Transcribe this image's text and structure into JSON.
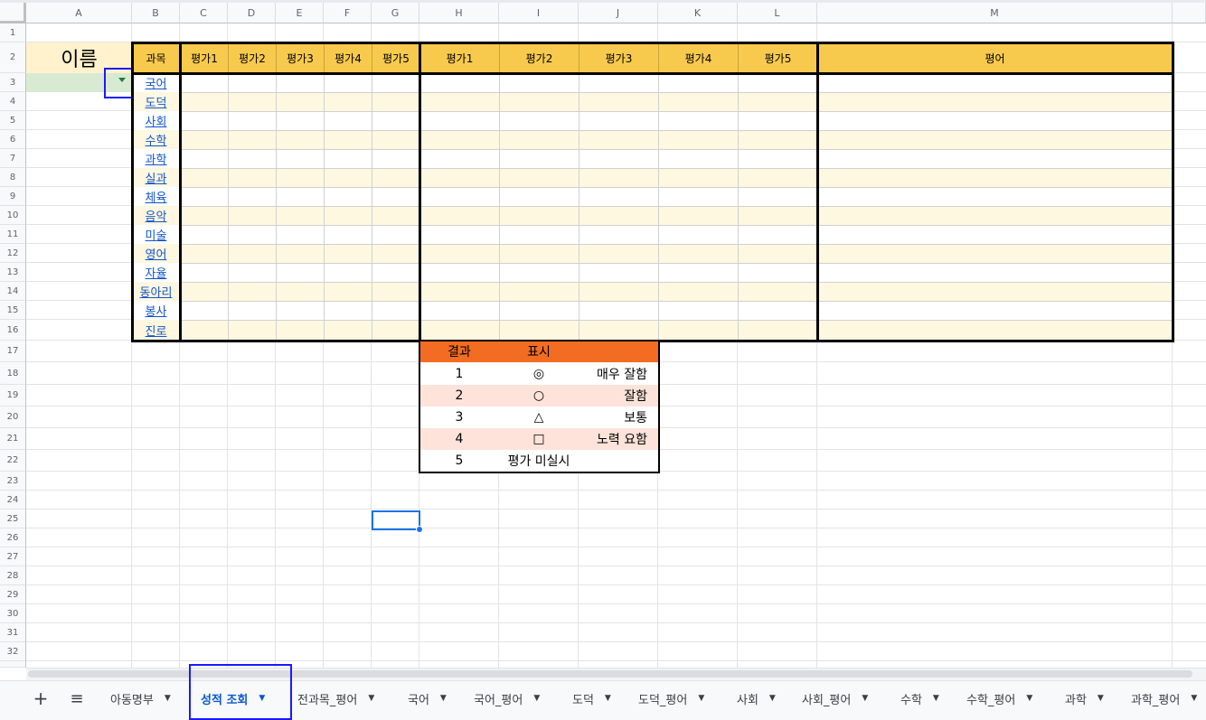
{
  "columns": [
    "A",
    "B",
    "C",
    "D",
    "E",
    "F",
    "G",
    "H",
    "I",
    "J",
    "K",
    "L",
    "M"
  ],
  "rows": [
    "1",
    "2",
    "3",
    "4",
    "5",
    "6",
    "7",
    "8",
    "9",
    "10",
    "11",
    "12",
    "13",
    "14",
    "15",
    "16",
    "17",
    "18",
    "19",
    "20",
    "21",
    "22",
    "23",
    "24",
    "25",
    "26",
    "27",
    "28",
    "29",
    "30",
    "31",
    "32"
  ],
  "name_label": "이름",
  "table": {
    "subject_header": "과목",
    "eval_headers_a": [
      "평가1",
      "평가2",
      "평가3",
      "평가4",
      "평가5"
    ],
    "eval_headers_b": [
      "평가1",
      "평가2",
      "평가3",
      "평가4",
      "평가5"
    ],
    "comment_header": "평어",
    "subjects": [
      "국어",
      "도덕",
      "사회",
      "수학",
      "과학",
      "실과",
      "체육",
      "음악",
      "미술",
      "영어",
      "자율",
      "동아리",
      "봉사",
      "진로"
    ]
  },
  "legend": {
    "headers": [
      "결과",
      "표시"
    ],
    "rows": [
      {
        "num": "1",
        "symbol": "◎",
        "desc": "매우 잘함"
      },
      {
        "num": "2",
        "symbol": "○",
        "desc": "잘함"
      },
      {
        "num": "3",
        "symbol": "△",
        "desc": "보통"
      },
      {
        "num": "4",
        "symbol": "□",
        "desc": "노력 요함"
      },
      {
        "num": "5",
        "symbol": "평가 미실시",
        "desc": ""
      }
    ]
  },
  "sheet_tabs": {
    "add_label": "+",
    "menu_label": "≡",
    "tabs": [
      "아동명부",
      "성적 조회",
      "전과목_평어",
      "국어",
      "국어_평어",
      "도덕",
      "도덕_평어",
      "사회",
      "사회_평어",
      "수학",
      "수학_평어",
      "과학",
      "과학_평어"
    ],
    "active_tab": "성적 조회"
  },
  "colors": {
    "header_yellow": "#f7ca4e",
    "stripe_cream": "#fff8e1",
    "legend_orange": "#f26c22",
    "legend_pink": "#fde3d9",
    "name_green": "#d9ead3",
    "selection_blue": "#1a73e8",
    "link_blue": "#1155cc"
  }
}
